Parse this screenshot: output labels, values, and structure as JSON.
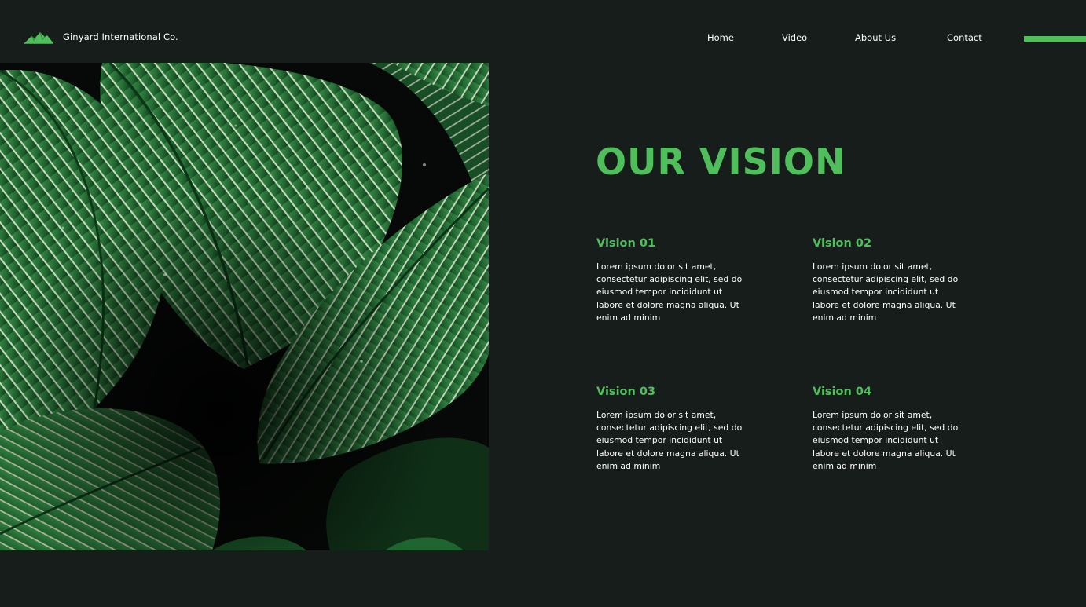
{
  "header": {
    "brand": {
      "name": "Ginyard International Co.",
      "logo_icon": "mountain-logo-icon"
    },
    "nav": [
      {
        "label": "Home"
      },
      {
        "label": "Video"
      },
      {
        "label": "About Us"
      },
      {
        "label": "Contact"
      }
    ]
  },
  "hero": {
    "image_subject": "calathea-leaves-photo"
  },
  "vision": {
    "title": "OUR VISION",
    "items": [
      {
        "title": "Vision 01",
        "text": "Lorem ipsum dolor sit amet, consectetur adipiscing elit, sed do eiusmod tempor incididunt ut labore et dolore magna aliqua. Ut enim ad minim"
      },
      {
        "title": "Vision 02",
        "text": "Lorem ipsum dolor sit amet, consectetur adipiscing elit, sed do eiusmod tempor incididunt ut labore et dolore magna aliqua. Ut enim ad minim"
      },
      {
        "title": "Vision 03",
        "text": "Lorem ipsum dolor sit amet, consectetur adipiscing elit, sed do eiusmod tempor incididunt ut labore et dolore magna aliqua. Ut enim ad minim"
      },
      {
        "title": "Vision 04",
        "text": "Lorem ipsum dolor sit amet, consectetur adipiscing elit, sed do eiusmod tempor incididunt ut labore et dolore magna aliqua. Ut enim ad minim"
      }
    ]
  },
  "colors": {
    "background": "#171d1a",
    "accent": "#4fbf5b",
    "text": "#ffffff"
  }
}
